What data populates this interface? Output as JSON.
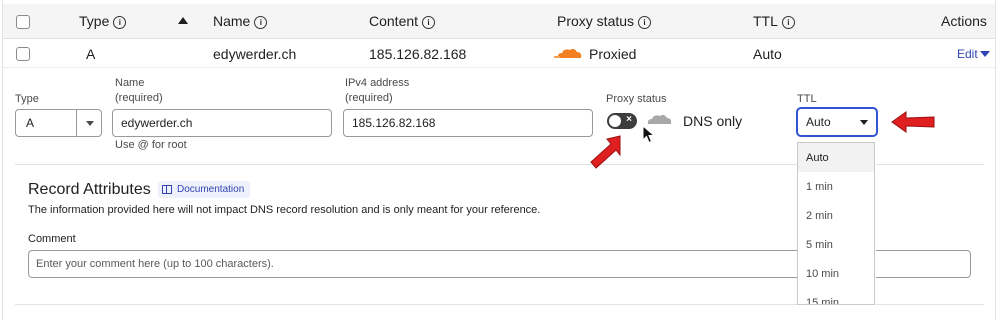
{
  "table_header": {
    "type": "Type",
    "name": "Name",
    "content": "Content",
    "proxy_status": "Proxy status",
    "ttl": "TTL",
    "actions": "Actions"
  },
  "record": {
    "type": "A",
    "name": "edywerder.ch",
    "content": "185.126.82.168",
    "proxy_status": "Proxied",
    "ttl": "Auto",
    "edit": "Edit"
  },
  "edit_form": {
    "type_label": "Type",
    "type_value": "A",
    "name_label_1": "Name",
    "name_label_2": "(required)",
    "name_value": "edywerder.ch",
    "name_hint": "Use @ for root",
    "ipv4_label_1": "IPv4 address",
    "ipv4_label_2": "(required)",
    "ipv4_value": "185.126.82.168",
    "proxy_label": "Proxy status",
    "proxy_state_text": "DNS only",
    "ttl_label": "TTL",
    "ttl_value": "Auto",
    "ttl_options": [
      "Auto",
      "1 min",
      "2 min",
      "5 min",
      "10 min",
      "15 min"
    ]
  },
  "record_attributes": {
    "title": "Record Attributes",
    "doc_link": "Documentation",
    "description": "The information provided here will not impact DNS record resolution and is only meant for your reference.",
    "comment_label": "Comment",
    "comment_placeholder": "Enter your comment here (up to 100 characters)."
  },
  "colors": {
    "accent": "#3044b5",
    "proxied_orange": "#f38020",
    "arrow_red": "#e02020",
    "toggle_dark": "#3d3d3d"
  }
}
